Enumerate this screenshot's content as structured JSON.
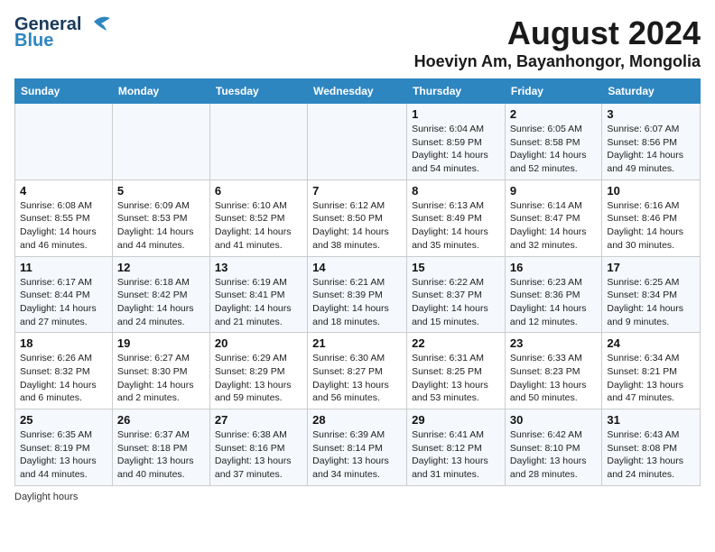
{
  "header": {
    "logo_line1": "General",
    "logo_line2": "Blue",
    "month_title": "August 2024",
    "location": "Hoeviyn Am, Bayanhongor, Mongolia"
  },
  "days_of_week": [
    "Sunday",
    "Monday",
    "Tuesday",
    "Wednesday",
    "Thursday",
    "Friday",
    "Saturday"
  ],
  "weeks": [
    [
      {
        "day": "",
        "info": ""
      },
      {
        "day": "",
        "info": ""
      },
      {
        "day": "",
        "info": ""
      },
      {
        "day": "",
        "info": ""
      },
      {
        "day": "1",
        "info": "Sunrise: 6:04 AM\nSunset: 8:59 PM\nDaylight: 14 hours and 54 minutes."
      },
      {
        "day": "2",
        "info": "Sunrise: 6:05 AM\nSunset: 8:58 PM\nDaylight: 14 hours and 52 minutes."
      },
      {
        "day": "3",
        "info": "Sunrise: 6:07 AM\nSunset: 8:56 PM\nDaylight: 14 hours and 49 minutes."
      }
    ],
    [
      {
        "day": "4",
        "info": "Sunrise: 6:08 AM\nSunset: 8:55 PM\nDaylight: 14 hours and 46 minutes."
      },
      {
        "day": "5",
        "info": "Sunrise: 6:09 AM\nSunset: 8:53 PM\nDaylight: 14 hours and 44 minutes."
      },
      {
        "day": "6",
        "info": "Sunrise: 6:10 AM\nSunset: 8:52 PM\nDaylight: 14 hours and 41 minutes."
      },
      {
        "day": "7",
        "info": "Sunrise: 6:12 AM\nSunset: 8:50 PM\nDaylight: 14 hours and 38 minutes."
      },
      {
        "day": "8",
        "info": "Sunrise: 6:13 AM\nSunset: 8:49 PM\nDaylight: 14 hours and 35 minutes."
      },
      {
        "day": "9",
        "info": "Sunrise: 6:14 AM\nSunset: 8:47 PM\nDaylight: 14 hours and 32 minutes."
      },
      {
        "day": "10",
        "info": "Sunrise: 6:16 AM\nSunset: 8:46 PM\nDaylight: 14 hours and 30 minutes."
      }
    ],
    [
      {
        "day": "11",
        "info": "Sunrise: 6:17 AM\nSunset: 8:44 PM\nDaylight: 14 hours and 27 minutes."
      },
      {
        "day": "12",
        "info": "Sunrise: 6:18 AM\nSunset: 8:42 PM\nDaylight: 14 hours and 24 minutes."
      },
      {
        "day": "13",
        "info": "Sunrise: 6:19 AM\nSunset: 8:41 PM\nDaylight: 14 hours and 21 minutes."
      },
      {
        "day": "14",
        "info": "Sunrise: 6:21 AM\nSunset: 8:39 PM\nDaylight: 14 hours and 18 minutes."
      },
      {
        "day": "15",
        "info": "Sunrise: 6:22 AM\nSunset: 8:37 PM\nDaylight: 14 hours and 15 minutes."
      },
      {
        "day": "16",
        "info": "Sunrise: 6:23 AM\nSunset: 8:36 PM\nDaylight: 14 hours and 12 minutes."
      },
      {
        "day": "17",
        "info": "Sunrise: 6:25 AM\nSunset: 8:34 PM\nDaylight: 14 hours and 9 minutes."
      }
    ],
    [
      {
        "day": "18",
        "info": "Sunrise: 6:26 AM\nSunset: 8:32 PM\nDaylight: 14 hours and 6 minutes."
      },
      {
        "day": "19",
        "info": "Sunrise: 6:27 AM\nSunset: 8:30 PM\nDaylight: 14 hours and 2 minutes."
      },
      {
        "day": "20",
        "info": "Sunrise: 6:29 AM\nSunset: 8:29 PM\nDaylight: 13 hours and 59 minutes."
      },
      {
        "day": "21",
        "info": "Sunrise: 6:30 AM\nSunset: 8:27 PM\nDaylight: 13 hours and 56 minutes."
      },
      {
        "day": "22",
        "info": "Sunrise: 6:31 AM\nSunset: 8:25 PM\nDaylight: 13 hours and 53 minutes."
      },
      {
        "day": "23",
        "info": "Sunrise: 6:33 AM\nSunset: 8:23 PM\nDaylight: 13 hours and 50 minutes."
      },
      {
        "day": "24",
        "info": "Sunrise: 6:34 AM\nSunset: 8:21 PM\nDaylight: 13 hours and 47 minutes."
      }
    ],
    [
      {
        "day": "25",
        "info": "Sunrise: 6:35 AM\nSunset: 8:19 PM\nDaylight: 13 hours and 44 minutes."
      },
      {
        "day": "26",
        "info": "Sunrise: 6:37 AM\nSunset: 8:18 PM\nDaylight: 13 hours and 40 minutes."
      },
      {
        "day": "27",
        "info": "Sunrise: 6:38 AM\nSunset: 8:16 PM\nDaylight: 13 hours and 37 minutes."
      },
      {
        "day": "28",
        "info": "Sunrise: 6:39 AM\nSunset: 8:14 PM\nDaylight: 13 hours and 34 minutes."
      },
      {
        "day": "29",
        "info": "Sunrise: 6:41 AM\nSunset: 8:12 PM\nDaylight: 13 hours and 31 minutes."
      },
      {
        "day": "30",
        "info": "Sunrise: 6:42 AM\nSunset: 8:10 PM\nDaylight: 13 hours and 28 minutes."
      },
      {
        "day": "31",
        "info": "Sunrise: 6:43 AM\nSunset: 8:08 PM\nDaylight: 13 hours and 24 minutes."
      }
    ]
  ],
  "footer": {
    "note": "Daylight hours"
  }
}
